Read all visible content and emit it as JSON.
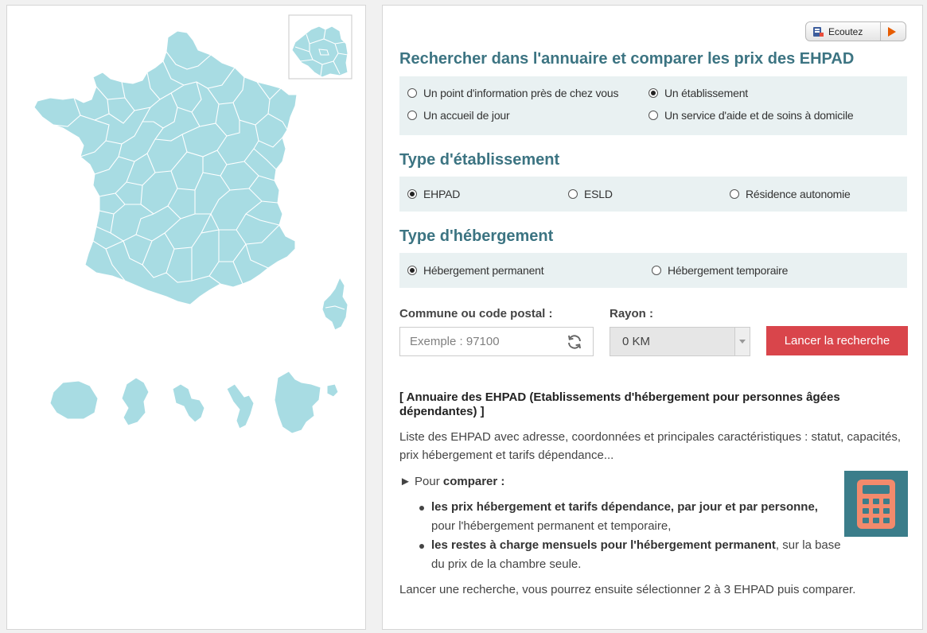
{
  "listen": {
    "label": "Ecoutez"
  },
  "title": "Rechercher dans l'annuaire et comparer les prix des EHPAD",
  "info_types": {
    "options": [
      {
        "label": "Un point d'information près de chez vous",
        "checked": false
      },
      {
        "label": "Un établissement",
        "checked": true
      },
      {
        "label": "Un accueil de jour",
        "checked": false
      },
      {
        "label": "Un service d'aide et de soins à domicile",
        "checked": false
      }
    ]
  },
  "establishment": {
    "heading": "Type d'établissement",
    "options": [
      {
        "label": "EHPAD",
        "checked": true
      },
      {
        "label": "ESLD",
        "checked": false
      },
      {
        "label": "Résidence autonomie",
        "checked": false
      }
    ]
  },
  "lodging": {
    "heading": "Type d'hébergement",
    "options": [
      {
        "label": "Hébergement permanent",
        "checked": true
      },
      {
        "label": "Hébergement temporaire",
        "checked": false
      }
    ]
  },
  "form": {
    "commune_label": "Commune ou code postal :",
    "commune_placeholder": "Exemple : 97100",
    "commune_value": "",
    "rayon_label": "Rayon :",
    "rayon_value": "0 KM",
    "search_button": "Lancer la recherche"
  },
  "description": {
    "title": "[ Annuaire des EHPAD (Etablissements d'hébergement pour personnes âgées dépendantes) ]",
    "intro": "Liste des EHPAD avec adresse, coordonnées et principales caractéristiques : statut, capacités, prix hébergement et tarifs dépendance...",
    "compare_prefix": "► Pour ",
    "compare_bold": "comparer :",
    "bullets": [
      {
        "bold": "les prix hébergement et tarifs dépendance, par jour et par personne,",
        "rest": " pour l'hébergement permanent et temporaire,"
      },
      {
        "bold": "les restes à charge mensuels pour l'hébergement permanent",
        "rest": ", sur la base du prix de la chambre seule."
      }
    ],
    "footer": "Lancer une recherche, vous pourrez ensuite sélectionner 2 à 3 EHPAD puis comparer."
  },
  "colors": {
    "map_fill": "#a8dce3",
    "heading": "#3c7482",
    "search_button": "#d9454b",
    "calculator_bg": "#3b7d8a",
    "calculator_fg": "#f28a6c"
  },
  "icons": [
    "speaker-icon",
    "play-icon",
    "refresh-icon",
    "chevron-down-icon",
    "calculator-icon"
  ]
}
